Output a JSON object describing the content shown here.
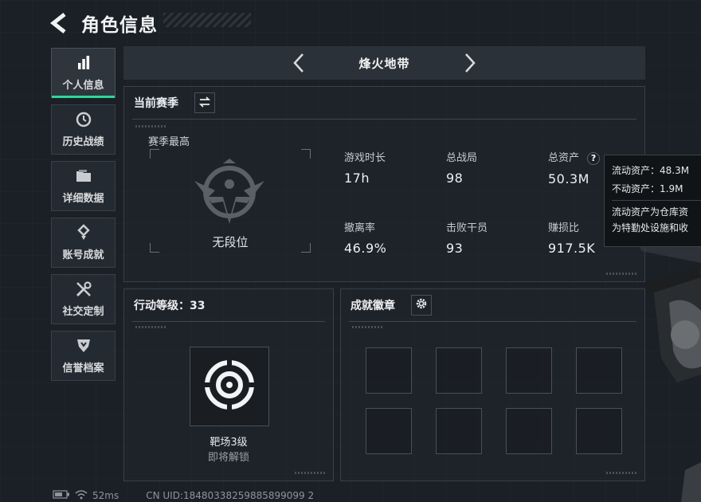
{
  "header": {
    "title": "角色信息"
  },
  "sidebar": {
    "items": [
      {
        "label": "个人信息",
        "icon": "bar-chart-icon",
        "active": true
      },
      {
        "label": "历史战绩",
        "icon": "history-icon",
        "active": false
      },
      {
        "label": "详细数据",
        "icon": "folder-icon",
        "active": false
      },
      {
        "label": "账号成就",
        "icon": "achievement-icon",
        "active": false
      },
      {
        "label": "社交定制",
        "icon": "tools-icon",
        "active": false
      },
      {
        "label": "信誉档案",
        "icon": "reputation-icon",
        "active": false
      }
    ]
  },
  "mode": {
    "title": "烽火地带"
  },
  "season": {
    "title": "当前赛季",
    "best_label": "赛季最高",
    "rank_label": "无段位",
    "stats": [
      {
        "label": "游戏时长",
        "value": "17h"
      },
      {
        "label": "总战局",
        "value": "98"
      },
      {
        "label": "总资产",
        "value": "50.3M",
        "help": "?"
      },
      {
        "label": "撤离率",
        "value": "46.9%"
      },
      {
        "label": "击败干员",
        "value": "93"
      },
      {
        "label": "赚损比",
        "value": "917.5K"
      }
    ]
  },
  "tooltip": {
    "line1": "流动资产：48.3M",
    "line2": "不动资产：1.9M",
    "desc1": "流动资产为仓库资",
    "desc2": "为特勤处设施和收"
  },
  "level": {
    "title": "行动等级：33",
    "name": "靶场3级",
    "sub": "即将解锁"
  },
  "badges": {
    "title": "成就徽章"
  },
  "footer": {
    "ping": "52ms",
    "uid": "CN UID:18480338259885899099 2"
  },
  "colors": {
    "accent": "#2fd69a",
    "background": "#1b2026",
    "panel_border": "#3a4048"
  }
}
